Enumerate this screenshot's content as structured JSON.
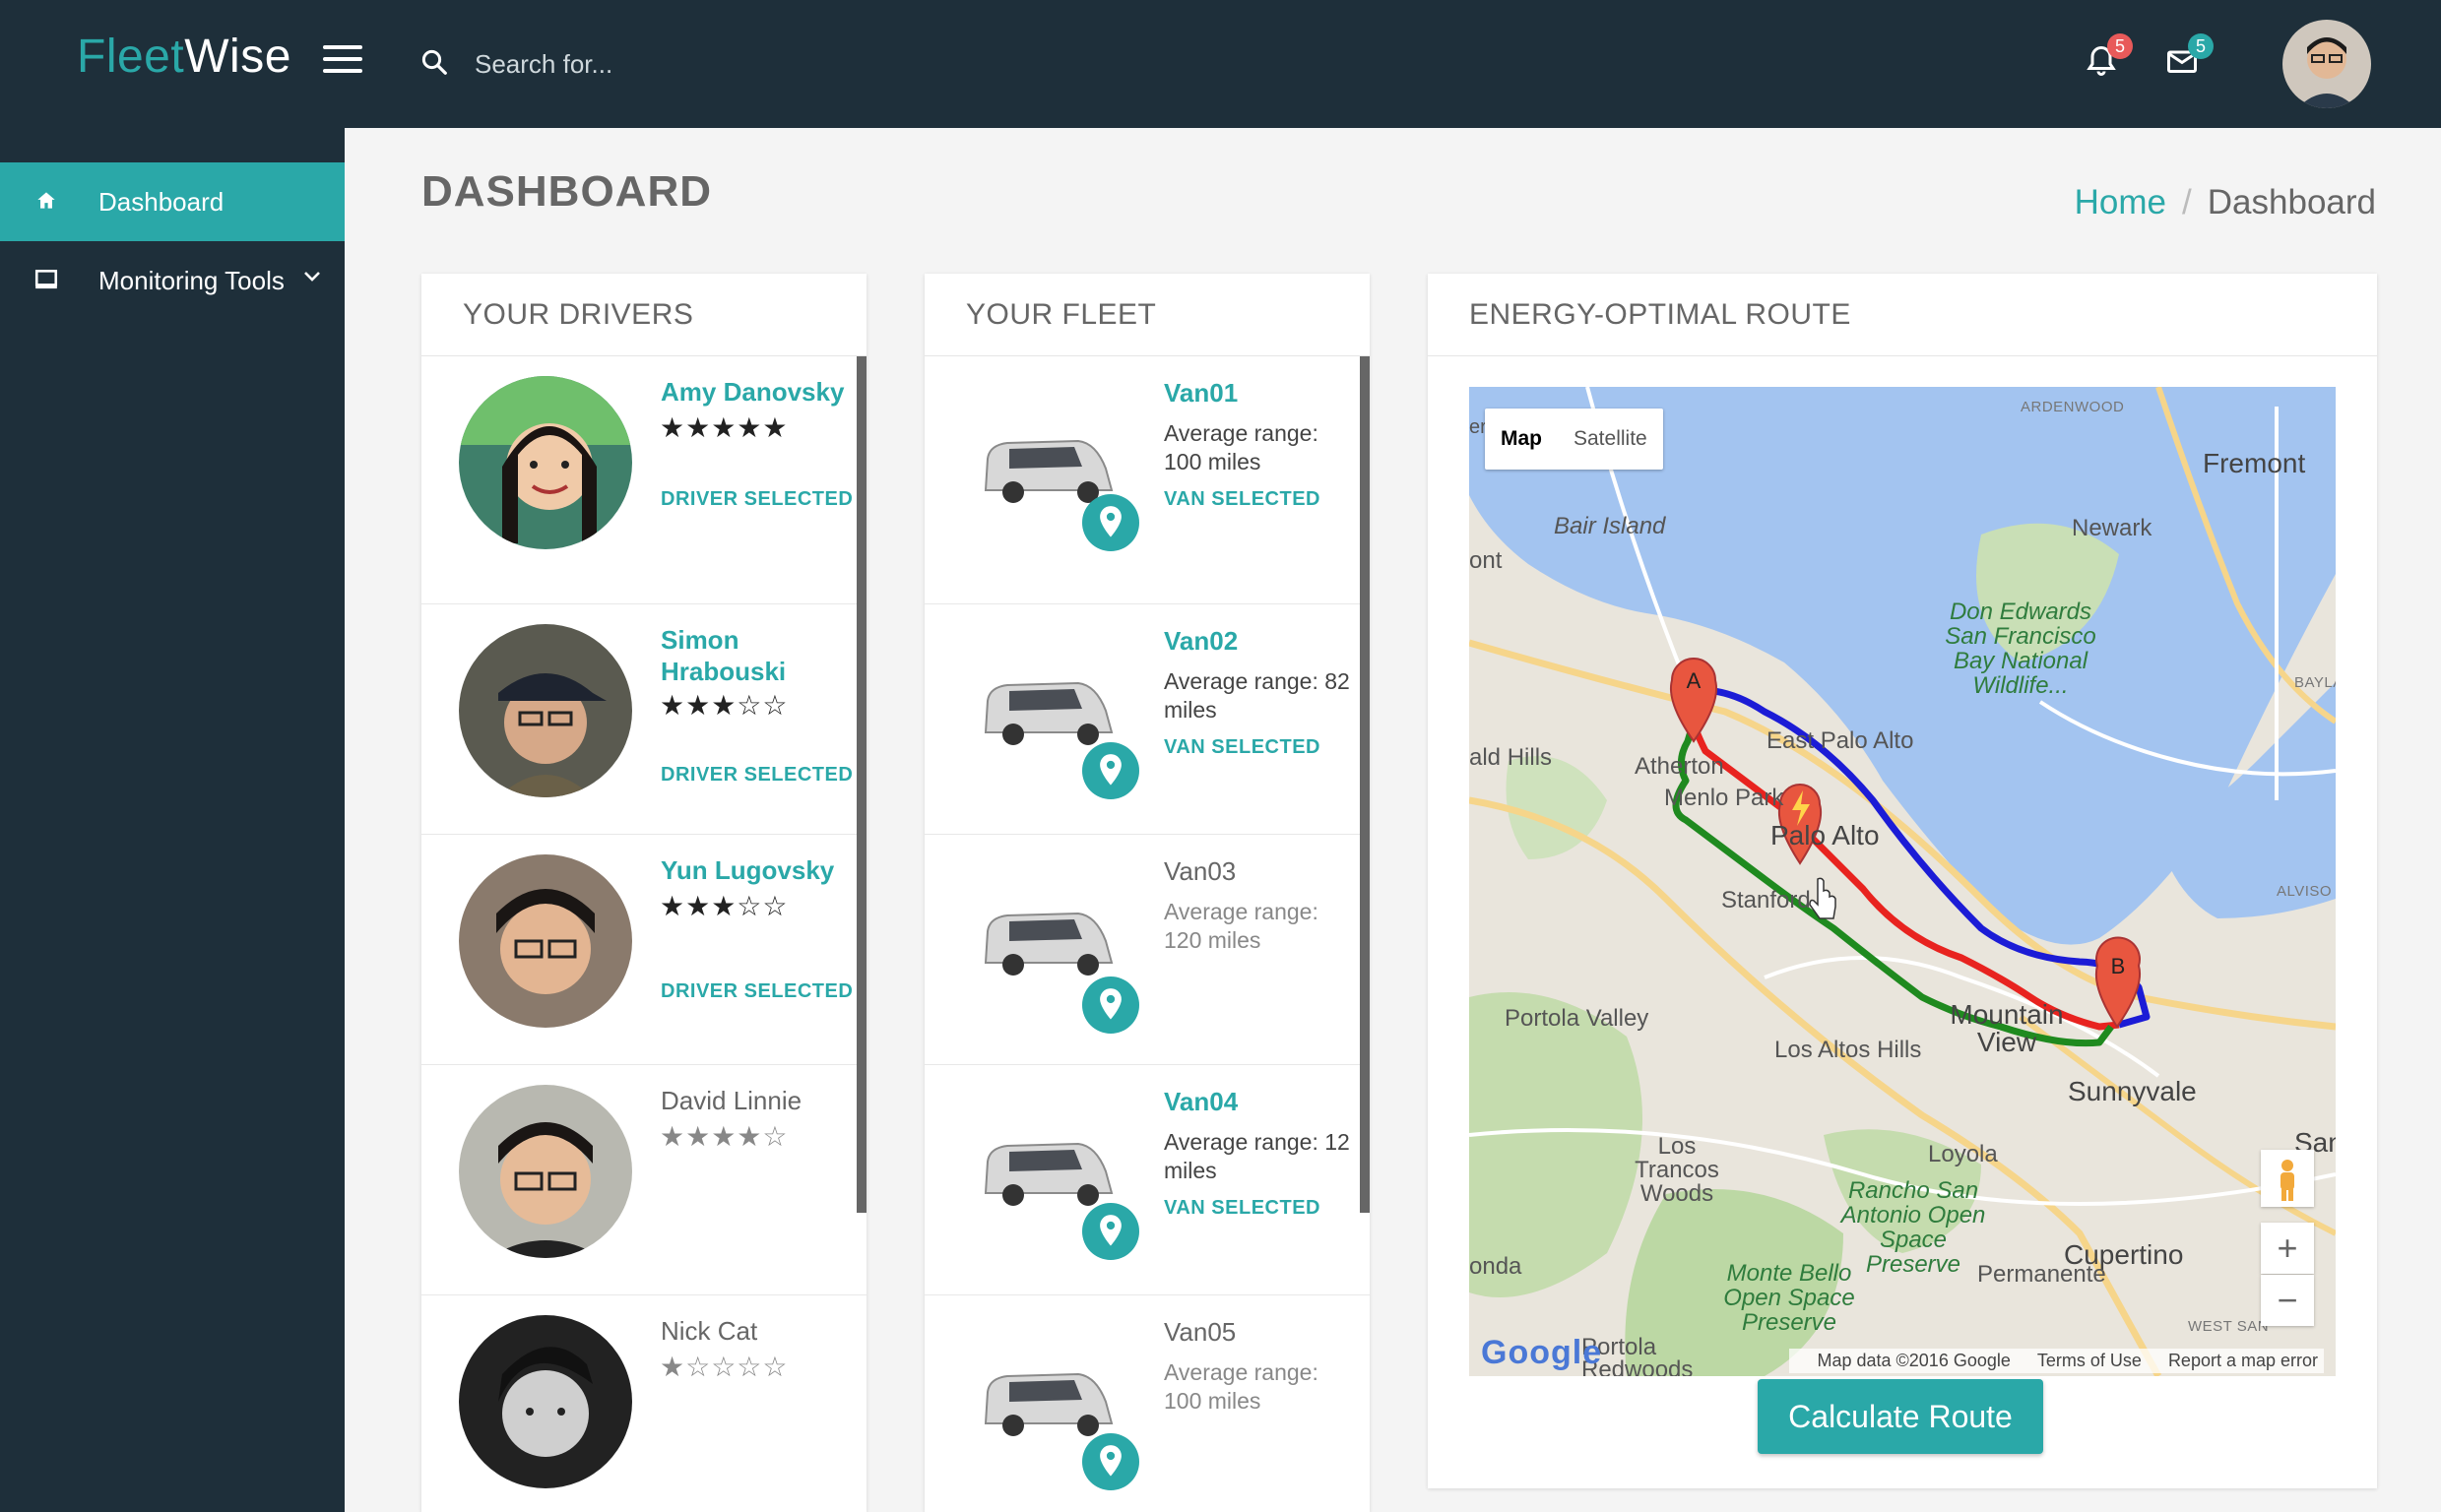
{
  "brand": {
    "part1": "Fleet",
    "part2": "Wise"
  },
  "search": {
    "placeholder": "Search for..."
  },
  "notifications": {
    "bell_count": "5",
    "mail_count": "5"
  },
  "sidebar": {
    "items": [
      {
        "label": "Dashboard",
        "icon": "home-icon",
        "active": true
      },
      {
        "label": "Monitoring Tools",
        "icon": "monitor-icon",
        "active": false
      }
    ]
  },
  "page": {
    "title": "DASHBOARD",
    "breadcrumb": {
      "home": "Home",
      "sep": "/",
      "current": "Dashboard"
    }
  },
  "drivers": {
    "header": "YOUR DRIVERS",
    "items": [
      {
        "name": "Amy Danovsky",
        "stars": "★★★★★",
        "status": "DRIVER SELECTED"
      },
      {
        "name": "Simon Hrabouski",
        "stars": "★★★☆☆",
        "status": "DRIVER SELECTED"
      },
      {
        "name": "Yun Lugovsky",
        "stars": "★★★☆☆",
        "status": "DRIVER SELECTED"
      },
      {
        "name": "David Linnie",
        "stars": "★★★★☆",
        "status": ""
      },
      {
        "name": "Nick Cat",
        "stars": "★☆☆☆☆",
        "status": ""
      }
    ]
  },
  "fleet": {
    "header": "YOUR FLEET",
    "items": [
      {
        "name": "Van01",
        "range": "Average range: 100 miles",
        "status": "VAN SELECTED"
      },
      {
        "name": "Van02",
        "range": "Average range: 82 miles",
        "status": "VAN SELECTED"
      },
      {
        "name": "Van03",
        "range": "Average range: 120 miles",
        "status": ""
      },
      {
        "name": "Van04",
        "range": "Average range: 12 miles",
        "status": "VAN SELECTED"
      },
      {
        "name": "Van05",
        "range": "Average range: 100 miles",
        "status": ""
      }
    ]
  },
  "route": {
    "header": "ENERGY-OPTIMAL ROUTE",
    "map_toggle": {
      "map": "Map",
      "satellite": "Satellite"
    },
    "map_labels": {
      "ardenwood": "ARDENWOOD",
      "fremont": "Fremont",
      "bair_island": "Bair Island",
      "newark": "Newark",
      "ont": "ont",
      "don_edwards": "Don Edwards San Francisco Bay National Wildlife...",
      "east_palo_alto": "East Palo Alto",
      "atherton": "Atherton",
      "menlo_park": "Menlo Park",
      "palo_alto": "Palo Alto",
      "ald_hills": "ald Hills",
      "stanford": "Stanford",
      "alviso": "ALVISO",
      "bayla": "BAYLA",
      "portola_valley": "Portola Valley",
      "mountain_view": "Mountain View",
      "los_altos_hills": "Los Altos Hills",
      "sunnyvale": "Sunnyvale",
      "los_trancos": "Los Trancos Woods",
      "loyola": "Loyola",
      "rancho_san_antonio": "Rancho San Antonio Open Space Preserve",
      "cupertino": "Cupertino",
      "onda": "onda",
      "monte_bello": "Monte Bello Open Space Preserve",
      "permanente": "Permanente",
      "west_san": "WEST SAN",
      "sant": "Sant",
      "portola_redwoods": "Portola Redwoods",
      "er": "er"
    },
    "route_colors": {
      "blue": "#1c1cd6",
      "red": "#e8231f",
      "green": "#1f8a1f"
    },
    "markers": {
      "a": "A",
      "b": "B"
    },
    "google": "Google",
    "map_data": "Map data ©2016 Google",
    "terms": "Terms of Use",
    "report": "Report a map error",
    "zoom_in": "+",
    "zoom_out": "−",
    "calculate": "Calculate Route"
  }
}
